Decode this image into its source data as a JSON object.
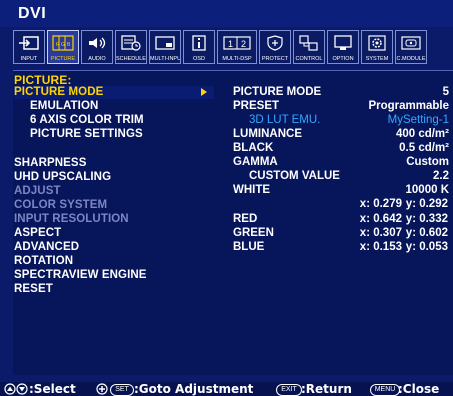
{
  "window": {
    "title": "DVI"
  },
  "toolbar": [
    {
      "label": "INPUT",
      "icon": "input-icon"
    },
    {
      "label": "PICTURE",
      "icon": "picture-icon"
    },
    {
      "label": "AUDIO",
      "icon": "audio-icon"
    },
    {
      "label": "SCHEDULE",
      "icon": "schedule-icon"
    },
    {
      "label": "MULTI-INPUT",
      "icon": "multi-input-icon"
    },
    {
      "label": "OSD",
      "icon": "osd-icon"
    },
    {
      "label": "MULTI-DSP",
      "icon": "multi-dsp-icon"
    },
    {
      "label": "PROTECT",
      "icon": "protect-icon"
    },
    {
      "label": "CONTROL",
      "icon": "control-icon"
    },
    {
      "label": "OPTION",
      "icon": "option-icon"
    },
    {
      "label": "SYSTEM",
      "icon": "system-icon"
    },
    {
      "label": "C.MODULE",
      "icon": "c-module-icon"
    }
  ],
  "menu": {
    "section": "PICTURE:",
    "items": [
      "PICTURE MODE",
      "EMULATION",
      "6 AXIS COLOR TRIM",
      "PICTURE SETTINGS",
      "SHARPNESS",
      "UHD UPSCALING",
      "ADJUST",
      "COLOR SYSTEM",
      "INPUT RESOLUTION",
      "ASPECT",
      "ADVANCED",
      "ROTATION",
      "SPECTRAVIEW ENGINE",
      "RESET"
    ]
  },
  "details": {
    "picture_mode": {
      "label": "PICTURE MODE",
      "value": "5"
    },
    "preset": {
      "label": "PRESET",
      "value": "Programmable"
    },
    "lut": {
      "label": "3D LUT EMU.",
      "value": "MySetting-1"
    },
    "luminance": {
      "label": "LUMINANCE",
      "value": "400 cd/m²"
    },
    "black": {
      "label": "BLACK",
      "value": "0.5 cd/m²"
    },
    "gamma": {
      "label": "GAMMA",
      "value": "Custom"
    },
    "custom_value": {
      "label": "CUSTOM VALUE",
      "value": "2.2"
    },
    "white": {
      "label": "WHITE",
      "value": "10000 K",
      "x": "x: 0.279",
      "y": "y: 0.292"
    },
    "red": {
      "label": "RED",
      "x": "x: 0.642",
      "y": "y: 0.332"
    },
    "green": {
      "label": "GREEN",
      "x": "x: 0.307",
      "y": "y: 0.602"
    },
    "blue": {
      "label": "BLUE",
      "x": "x: 0.153",
      "y": "y: 0.053"
    }
  },
  "footer": {
    "select": ":Select",
    "set_key": "SET",
    "goto": ":Goto Adjustment",
    "exit_key": "EXIT",
    "return": ":Return",
    "menu_key": "MENU",
    "close": ":Close"
  },
  "colors": {
    "background": "#0b1b69",
    "selected": "#ffd400",
    "accent": "#33a8ff",
    "dimmed": "#7c86c4"
  }
}
